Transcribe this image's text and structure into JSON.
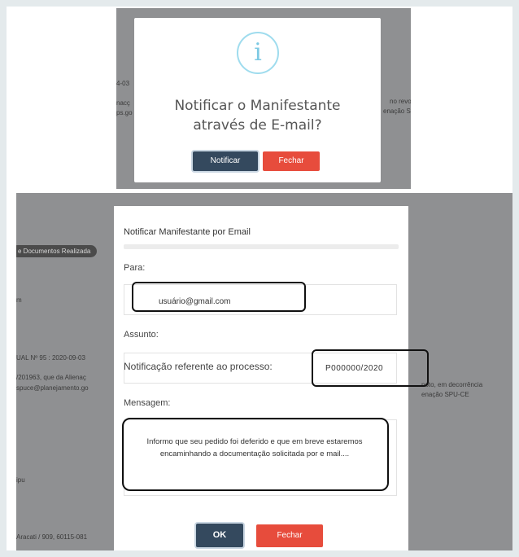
{
  "confirm_dialog": {
    "icon": "info-icon",
    "icon_glyph": "i",
    "title": "Notificar o Manifestante através de E-mail?",
    "notify_button": "Notificar",
    "close_button": "Fechar"
  },
  "background_top": {
    "fragments": [
      "4-03",
      "nacç",
      "no revo",
      "ps.go",
      "enação S"
    ]
  },
  "background_bottom": {
    "badge": "e Documentos Realizada",
    "fragments": [
      "m",
      "UAL Nº 95 : 2020-09-03",
      "/201963, que da Alienaç",
      "spuce@planejamento.go",
      "noto, em decorrência",
      "enação SPU-CE",
      "ipu",
      "Aracati / 909, 60115-081"
    ]
  },
  "email_modal": {
    "title": "Notificar Manifestante por Email",
    "to_label": "Para:",
    "to_value": "usuário@gmail.com",
    "subject_label": "Assunto:",
    "subject_text": "Notificação referente ao processo:",
    "process_number": "P000000/2020",
    "message_label": "Mensagem:",
    "message_text": "Informo que seu pedido foi deferido e que em breve estaremos encaminhando a documentação solicitada por e mail....",
    "ok_button": "OK",
    "close_button": "Fechar"
  },
  "colors": {
    "primary_button": "#34495e",
    "danger_button": "#e74c3c",
    "info_icon": "#7cc9e3",
    "overlay": "#8f9092"
  }
}
